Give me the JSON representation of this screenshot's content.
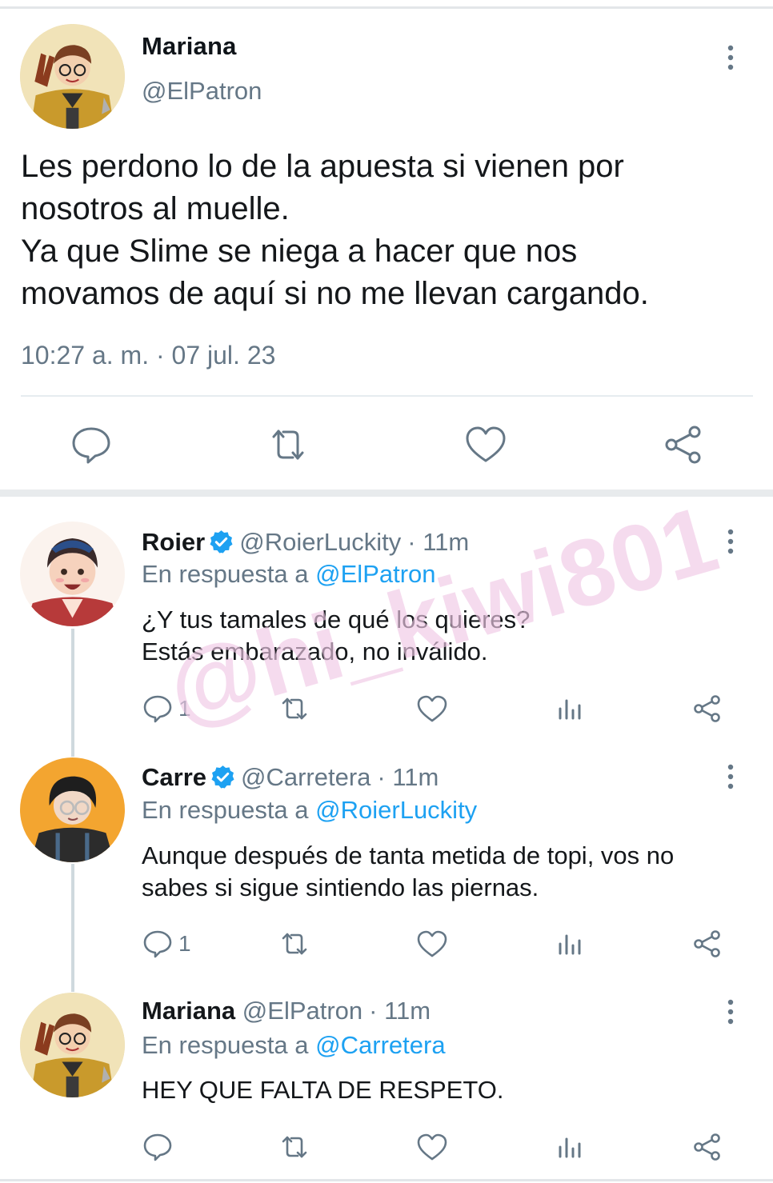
{
  "main_tweet": {
    "name": "Mariana",
    "handle": "@ElPatron",
    "text_lines": [
      "Les perdono lo de la apuesta si vienen por",
      "nosotros al muelle.",
      "Ya que Slime se niega a hacer que nos",
      "movamos de aquí si no me llevan cargando."
    ],
    "timestamp": "10:27 a. m. · 07 jul. 23"
  },
  "replies": [
    {
      "name": "Roier",
      "verified": true,
      "handle": "@RoierLuckity",
      "time": "· 11m",
      "reply_prefix": "En respuesta a",
      "reply_target": "@ElPatron",
      "text_lines": [
        "¿Y tus tamales de qué los quieres?",
        "Estás embarazado, no inválido."
      ],
      "reply_count": "1"
    },
    {
      "name": "Carre",
      "verified": true,
      "handle": "@Carretera",
      "time": "· 11m",
      "reply_prefix": "En respuesta a",
      "reply_target": "@RoierLuckity",
      "text_lines": [
        "Aunque después de tanta metida de topi, vos no",
        "sabes si sigue sintiendo las piernas."
      ],
      "reply_count": "1"
    },
    {
      "name": "Mariana",
      "verified": false,
      "handle": "@ElPatron",
      "time": "· 11m",
      "reply_prefix": "En respuesta a",
      "reply_target": "@Carretera",
      "text_lines": [
        "HEY QUE FALTA DE RESPETO."
      ],
      "reply_count": ""
    }
  ],
  "watermark": "@hi_kiwi801",
  "colors": {
    "link": "#1da1f2",
    "secondary_text": "#657786",
    "icon": "#657786",
    "verified": "#1da1f2",
    "watermark": "#f0c9e6"
  }
}
